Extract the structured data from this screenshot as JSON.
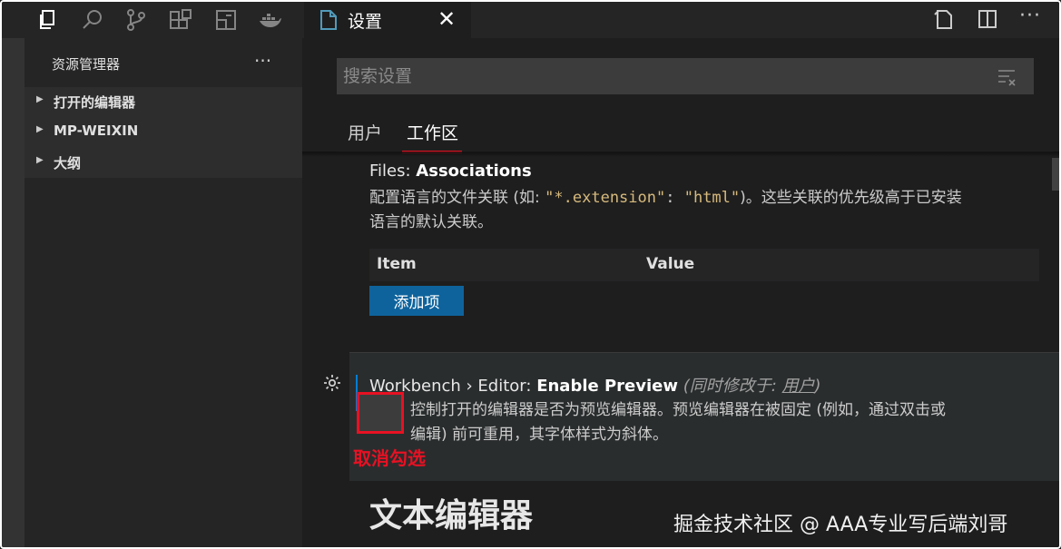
{
  "activity_bar": {
    "icons": [
      "explorer-icon",
      "search-icon",
      "source-control-icon",
      "extensions-icon",
      "remote-explorer-icon",
      "docker-icon"
    ]
  },
  "tab": {
    "label": "设置",
    "close": "✕",
    "icon": "file-icon"
  },
  "title_actions": {
    "icons": [
      "open-settings-json-icon",
      "split-editor-icon"
    ],
    "more": "···"
  },
  "sidebar": {
    "title": "资源管理器",
    "more": "···",
    "items": [
      {
        "caret": "▶",
        "label": "打开的编辑器"
      },
      {
        "caret": "▶",
        "label": "MP-WEIXIN"
      },
      {
        "caret": "▶",
        "label": "大纲"
      }
    ]
  },
  "settings": {
    "search_placeholder": "搜索设置",
    "scope_tabs": [
      "用户",
      "工作区"
    ],
    "active_scope": "工作区",
    "associations": {
      "title_prefix": "Files: ",
      "title_bold": "Associations",
      "desc_1": "配置语言的文件关联 (如: ",
      "desc_code_1": "\"*.extension\"",
      "desc_colon": ": ",
      "desc_code_2": "\"html\"",
      "desc_2": ")。这些关联的优先级高于已安装",
      "desc_3": "语言的默认关联。",
      "table_headers": [
        "Item",
        "Value"
      ],
      "add_button": "添加项"
    },
    "enable_preview": {
      "title_prefix": "Workbench › Editor: ",
      "title_bold": "Enable Preview",
      "modified_prefix": "(同时修改于: ",
      "modified_link": "用户",
      "modified_suffix": ")",
      "desc_1": "控制打开的编辑器是否为预览编辑器。预览编辑器在被固定 (例如，通过双击或",
      "desc_2": "编辑) 前可重用，其字体样式为斜体。",
      "checked": false
    },
    "annotation": "取消勾选",
    "section_heading": "文本编辑器"
  },
  "watermark": "掘金技术社区 @ AAA专业写后端刘哥",
  "colors": {
    "accent_red": "#e81123",
    "button_blue": "#0e639c",
    "focus_blue": "#007fd4"
  }
}
